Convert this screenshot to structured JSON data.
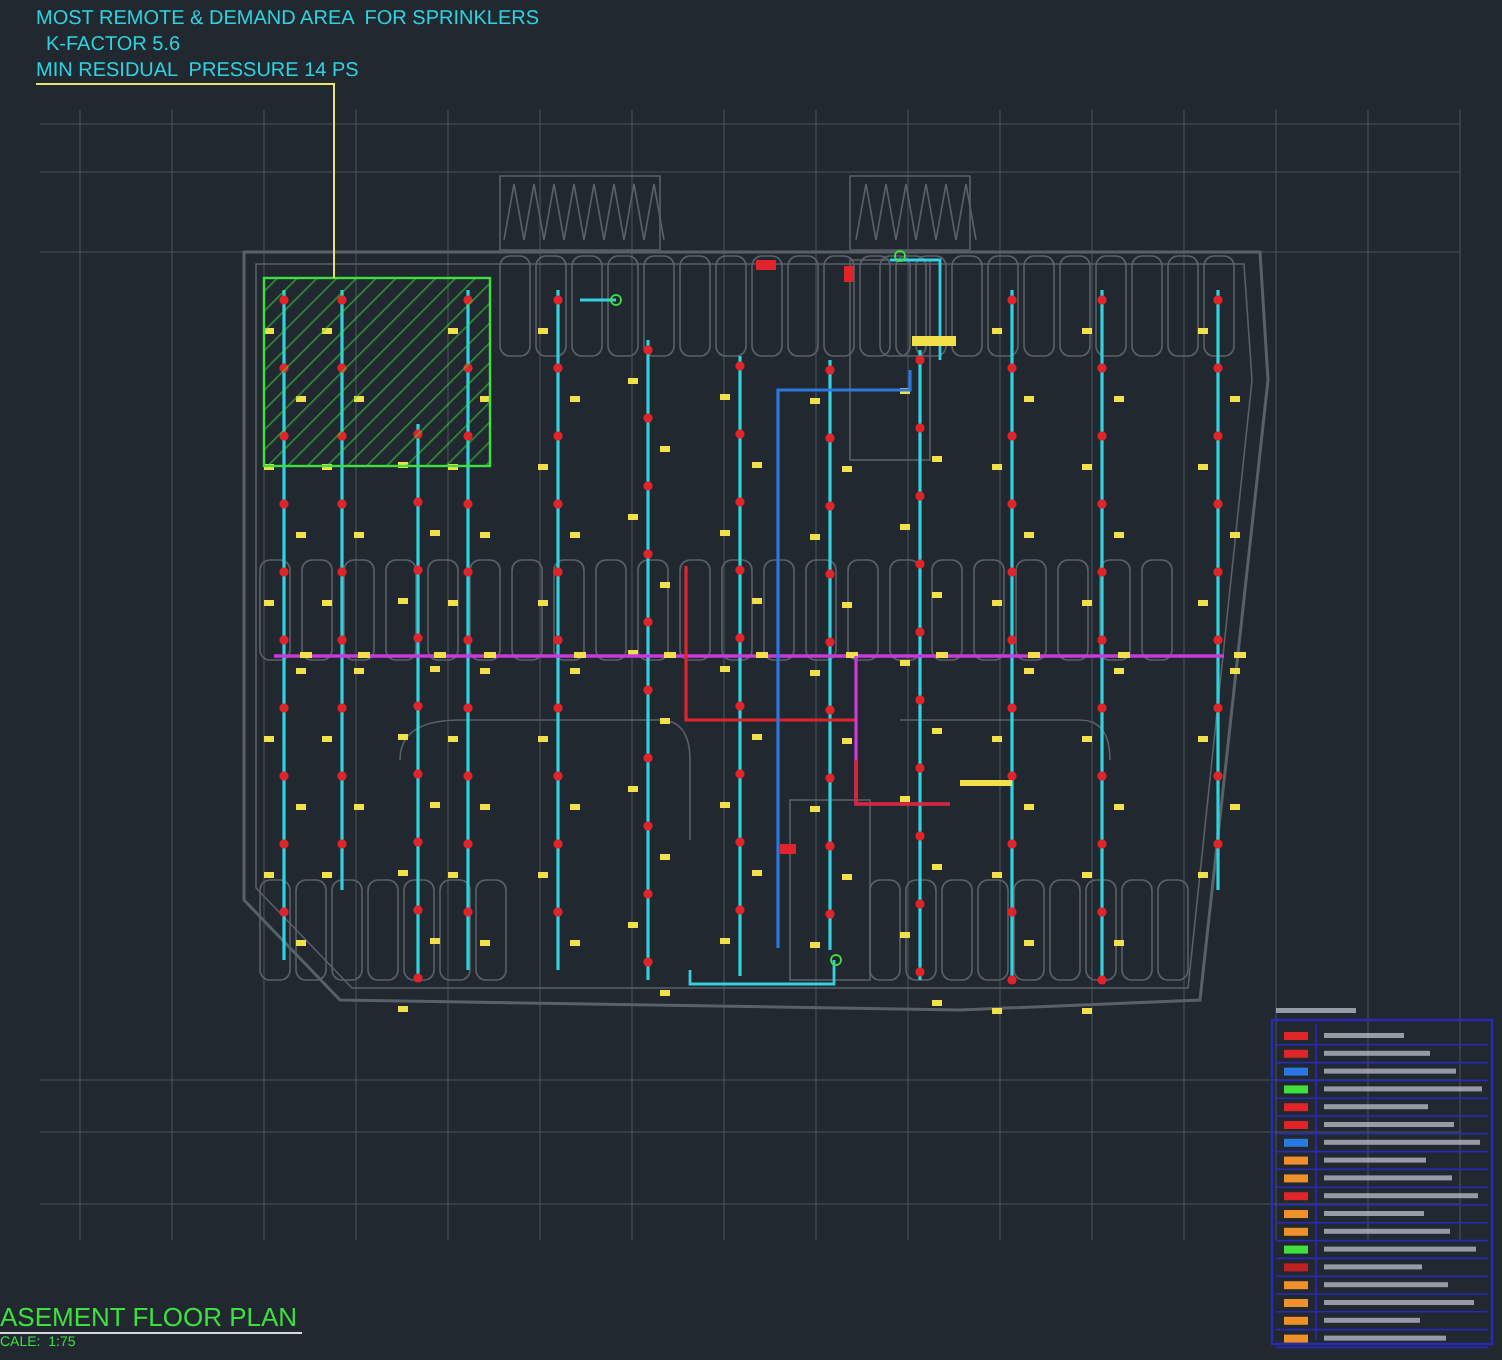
{
  "notes": [
    {
      "text": "MOST REMOTE & DEMAND AREA  FOR SPRINKLERS"
    },
    {
      "text": "K-FACTOR 5.6"
    },
    {
      "text": "MIN RESIDUAL  PRESSURE 14 PS"
    }
  ],
  "plan_title": "ASEMENT FLOOR PLAN",
  "plan_scale": "CALE:  1:75"
}
